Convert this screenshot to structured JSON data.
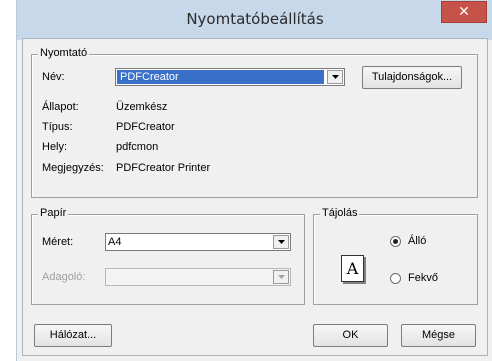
{
  "window": {
    "title": "Nyomtatóbeállítás",
    "close_glyph": "✕"
  },
  "printer_group": {
    "legend": "Nyomtató",
    "name_label": "Név:",
    "name_value": "PDFCreator",
    "properties_button": "Tulajdonságok...",
    "status_label": "Állapot:",
    "status_value": "Üzemkész",
    "type_label": "Típus:",
    "type_value": "PDFCreator",
    "location_label": "Hely:",
    "location_value": "pdfcmon",
    "comment_label": "Megjegyzés:",
    "comment_value": "PDFCreator Printer"
  },
  "paper_group": {
    "legend": "Papír",
    "size_label": "Méret:",
    "size_value": "A4",
    "source_label": "Adagoló:",
    "source_value": ""
  },
  "orientation_group": {
    "legend": "Tájolás",
    "icon_letter": "A",
    "portrait_label": "Álló",
    "landscape_label": "Fekvő",
    "selected": "portrait"
  },
  "buttons": {
    "network": "Hálózat...",
    "ok": "OK",
    "cancel": "Mégse"
  }
}
